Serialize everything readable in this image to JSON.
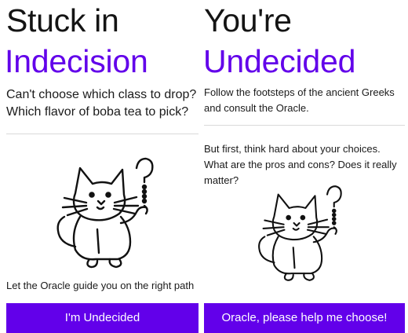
{
  "theme": {
    "accent": "#6200ea",
    "title_dark": "#141414",
    "divider": "#d9d9d9",
    "button_text": "#ffffff",
    "page_bg": "#ffffff"
  },
  "left_screen": {
    "title_line1": "Stuck in",
    "title_line2": "Indecision",
    "lead": "Can't choose which class to drop? Which flavor of boba tea to pick?",
    "illustration_icon": "cat-with-question-mark-icon",
    "guide_text": "Let the Oracle guide you on the right path",
    "button_label": "I'm Undecided"
  },
  "right_screen": {
    "title_line1": "You're",
    "title_line2": "Undecided",
    "lead": "Follow the footsteps of the ancient Greeks and consult the Oracle.",
    "question": "But first, think hard about your choices. What are the pros and cons? Does it really matter?",
    "illustration_icon": "cat-with-question-mark-icon",
    "button_label": "Oracle, please help me choose!"
  }
}
